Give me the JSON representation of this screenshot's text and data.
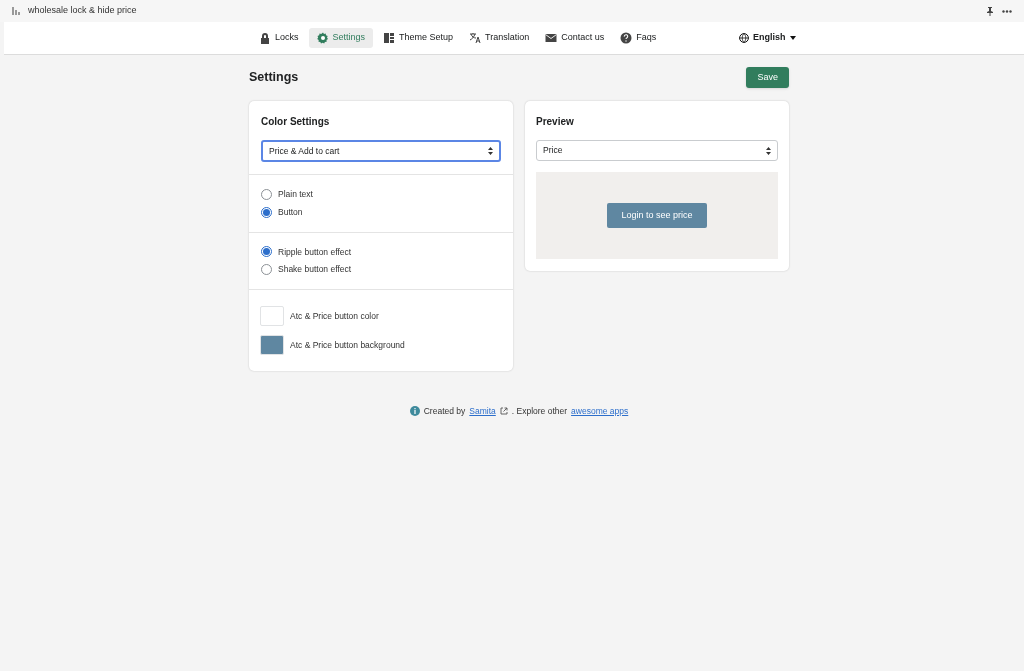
{
  "window": {
    "title": "wholesale lock & hide price"
  },
  "tabs": [
    {
      "kind": "lock",
      "label": "Locks",
      "selected": false
    },
    {
      "kind": "gear",
      "label": "Settings",
      "selected": true
    },
    {
      "kind": "layout",
      "label": "Theme Setup",
      "selected": false
    },
    {
      "kind": "translate",
      "label": "Translation",
      "selected": false
    },
    {
      "kind": "mail",
      "label": "Contact us",
      "selected": false
    },
    {
      "kind": "help",
      "label": "Faqs",
      "selected": false
    }
  ],
  "language": "English",
  "page_title": "Settings",
  "save_button": "Save",
  "color_settings": {
    "title": "Color Settings",
    "select": "Price & Add to cart",
    "display_options": [
      {
        "label": "Plain text",
        "selected": false
      },
      {
        "label": "Button",
        "selected": true
      }
    ],
    "effect_options": [
      {
        "label": "Ripple button effect",
        "selected": true
      },
      {
        "label": "Shake button effect",
        "selected": false
      }
    ],
    "colors": [
      {
        "label": "Atc & Price button color",
        "color": "#ffffff"
      },
      {
        "label": "Atc & Price button background",
        "color": "#5f87a1"
      }
    ]
  },
  "preview": {
    "title": "Preview",
    "select": "Price",
    "button": "Login to see price"
  },
  "footer": {
    "prefix": "Created by",
    "link": "Samita",
    "middle": ". Explore other",
    "link2": "awesome apps"
  }
}
